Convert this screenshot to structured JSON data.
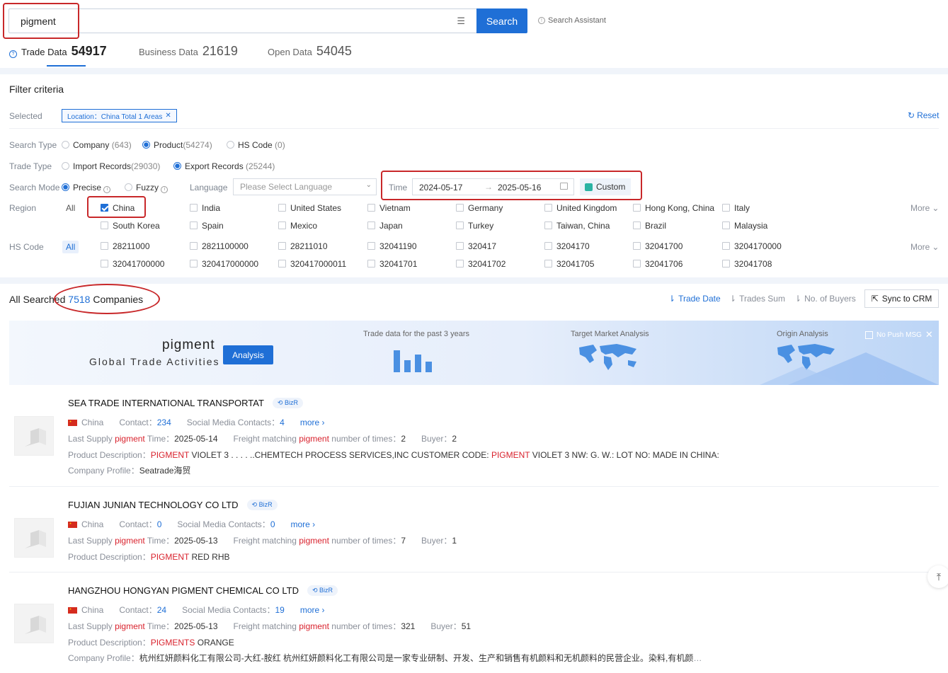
{
  "search": {
    "value": "pigment",
    "button": "Search",
    "assistant": "Search Assistant"
  },
  "tabs": [
    {
      "label": "Trade Data",
      "count": "54917"
    },
    {
      "label": "Business Data",
      "count": "21619"
    },
    {
      "label": "Open Data",
      "count": "54045"
    }
  ],
  "filter": {
    "title": "Filter criteria",
    "selected_label": "Selected",
    "selected_tag": "Location：China Total 1 Areas",
    "reset": "Reset",
    "search_type": {
      "label": "Search Type",
      "options": [
        {
          "name": "Company",
          "count": "(643)",
          "selected": false
        },
        {
          "name": "Product",
          "count": "(54274)",
          "selected": true
        },
        {
          "name": "HS Code",
          "count": "(0)",
          "selected": false
        }
      ]
    },
    "trade_type": {
      "label": "Trade Type",
      "options": [
        {
          "name": "Import Records",
          "count": "(29030)",
          "selected": false
        },
        {
          "name": "Export Records",
          "count": "(25244)",
          "selected": true
        }
      ]
    },
    "search_mode": {
      "label": "Search Mode",
      "precise": "Precise",
      "fuzzy": "Fuzzy"
    },
    "language": {
      "label": "Language",
      "placeholder": "Please Select Language"
    },
    "time": {
      "label": "Time",
      "start": "2024-05-17",
      "end": "2025-05-16",
      "custom": "Custom"
    },
    "region": {
      "label": "Region",
      "all": "All",
      "more": "More",
      "items": [
        "China",
        "India",
        "United States",
        "Vietnam",
        "Germany",
        "United Kingdom",
        "Hong Kong, China",
        "Italy",
        "South Korea",
        "Spain",
        "Mexico",
        "Japan",
        "Turkey",
        "Taiwan, China",
        "Brazil",
        "Malaysia"
      ]
    },
    "hs_code": {
      "label": "HS Code",
      "all": "All",
      "more": "More",
      "items": [
        "28211000",
        "2821100000",
        "28211010",
        "32041190",
        "320417",
        "3204170",
        "32041700",
        "3204170000",
        "32041700000",
        "320417000000",
        "320417000011",
        "32041701",
        "32041702",
        "32041705",
        "32041706",
        "32041708"
      ]
    }
  },
  "results": {
    "prefix": "All Searched",
    "count": "7518",
    "suffix": "Companies",
    "sort": {
      "trade_date": "Trade Date",
      "trades_sum": "Trades Sum",
      "buyers": "No. of Buyers"
    },
    "sync": "Sync to CRM"
  },
  "banner": {
    "title": "pigment",
    "subtitle": "Global Trade Activities",
    "button": "Analysis",
    "label1": "Trade data for the past 3 years",
    "label2": "Target Market Analysis",
    "label3": "Origin Analysis",
    "no_push": "No Push MSG"
  },
  "companies": [
    {
      "name": "SEA TRADE INTERNATIONAL TRANSPORTAT",
      "badge": "BizR",
      "country": "China",
      "contact": "234",
      "social": "4",
      "more": "more",
      "last_supply": "2025-05-14",
      "freight": "2",
      "buyer": "2",
      "desc_a": "PIGMENT",
      "desc_b": "VIOLET 3 . . . . ..CHEMTECH PROCESS SERVICES,INC CUSTOMER CODE:",
      "desc_c": "PIGMENT",
      "desc_d": "VIOLET 3 NW: G. W.: LOT NO: MADE IN CHINA:",
      "profile": "Seatrade海贸"
    },
    {
      "name": "FUJIAN JUNIAN TECHNOLOGY CO LTD",
      "badge": "BizR",
      "country": "China",
      "contact": "0",
      "social": "0",
      "more": "more",
      "last_supply": "2025-05-13",
      "freight": "7",
      "buyer": "1",
      "desc_a": "PIGMENT",
      "desc_b": "RED RHB"
    },
    {
      "name": "HANGZHOU HONGYAN PIGMENT CHEMICAL CO LTD",
      "badge": "BizR",
      "country": "China",
      "contact": "24",
      "social": "19",
      "more": "more",
      "last_supply": "2025-05-13",
      "freight": "321",
      "buyer": "51",
      "desc_a": "PIGMENTS",
      "desc_b": "ORANGE",
      "profile": "杭州红妍颜料化工有限公司-大红-胺红 杭州红妍颜料化工有限公司是一家专业研制、开发、生产和销售有机颜料和无机颜料的民营企业。染料,有机颜料,无机..."
    }
  ],
  "labels": {
    "contact": "Contact：",
    "social": "Social Media Contacts：",
    "last_supply_a": "Last Supply",
    "last_supply_b": "Time：",
    "freight_a": "Freight matching",
    "freight_b": "number of times：",
    "buyer": "Buyer：",
    "desc": "Product Description：",
    "profile": "Company Profile："
  }
}
